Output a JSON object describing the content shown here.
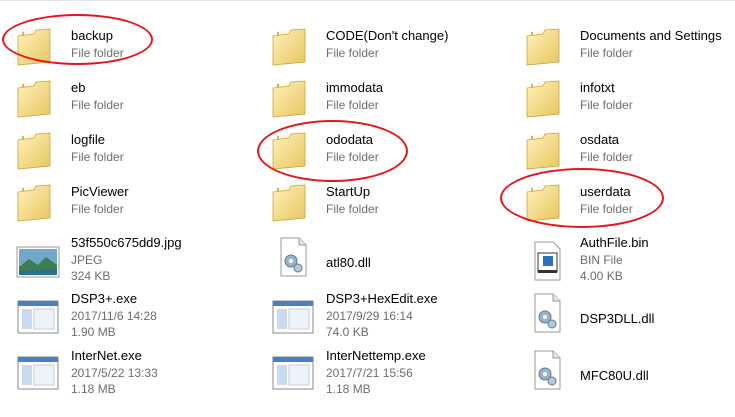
{
  "items": [
    {
      "name": "backup",
      "lines": [
        "File folder"
      ],
      "icon": "folder-icon"
    },
    {
      "name": "CODE(Don't change)",
      "lines": [
        "File folder"
      ],
      "icon": "folder-icon"
    },
    {
      "name": "Documents and Settings",
      "lines": [
        "File folder"
      ],
      "icon": "folder-icon"
    },
    {
      "name": "eb",
      "lines": [
        "File folder"
      ],
      "icon": "folder-icon"
    },
    {
      "name": "immodata",
      "lines": [
        "File folder"
      ],
      "icon": "folder-icon"
    },
    {
      "name": "infotxt",
      "lines": [
        "File folder"
      ],
      "icon": "folder-icon"
    },
    {
      "name": "logfile",
      "lines": [
        "File folder"
      ],
      "icon": "folder-icon"
    },
    {
      "name": "ododata",
      "lines": [
        "File folder"
      ],
      "icon": "folder-icon"
    },
    {
      "name": "osdata",
      "lines": [
        "File folder"
      ],
      "icon": "folder-icon"
    },
    {
      "name": "PicViewer",
      "lines": [
        "File folder"
      ],
      "icon": "folder-icon"
    },
    {
      "name": "StartUp",
      "lines": [
        "File folder"
      ],
      "icon": "folder-icon"
    },
    {
      "name": "userdata",
      "lines": [
        "File folder"
      ],
      "icon": "folder-icon"
    },
    {
      "name": "53f550c675dd9.jpg",
      "lines": [
        "JPEG",
        "324 KB"
      ],
      "icon": "image-file-icon"
    },
    {
      "name": "atl80.dll",
      "lines": [],
      "icon": "dll-file-icon"
    },
    {
      "name": "AuthFile.bin",
      "lines": [
        "BIN File",
        "4.00 KB"
      ],
      "icon": "bin-file-icon"
    },
    {
      "name": "DSP3+.exe",
      "lines": [
        "2017/11/6 14:28",
        "1.90 MB"
      ],
      "icon": "exe-file-icon"
    },
    {
      "name": "DSP3+HexEdit.exe",
      "lines": [
        "2017/9/29 16:14",
        "74.0 KB"
      ],
      "icon": "exe-file-icon"
    },
    {
      "name": "DSP3DLL.dll",
      "lines": [],
      "icon": "dll-file-icon"
    },
    {
      "name": "InterNet.exe",
      "lines": [
        "2017/5/22 13:33",
        "1.18 MB"
      ],
      "icon": "exe-file-icon"
    },
    {
      "name": "InterNettemp.exe",
      "lines": [
        "2017/7/21 15:56",
        "1.18 MB"
      ],
      "icon": "exe-file-icon"
    },
    {
      "name": "MFC80U.dll",
      "lines": [],
      "icon": "dll-file-icon"
    }
  ],
  "annotations": {
    "highlighted": [
      "backup",
      "ododata",
      "userdata"
    ],
    "color": "#e8141b"
  }
}
